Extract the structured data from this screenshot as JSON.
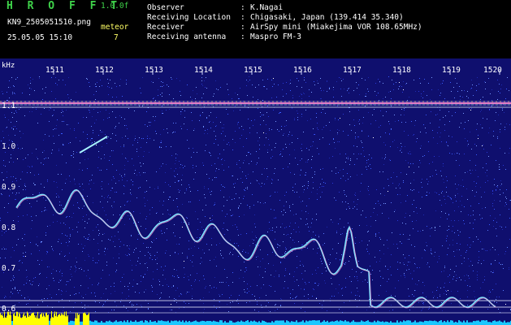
{
  "app": {
    "name": "H R O F F T",
    "version": "1.0.0f"
  },
  "file": {
    "name": "KN9_2505051510.png",
    "datetime": "25.05.05 15:10"
  },
  "meteor": {
    "label": "meteor",
    "count": "7"
  },
  "info": [
    {
      "label": "Observer",
      "value": "K.Nagai"
    },
    {
      "label": "Receiving Location",
      "value": "Chigasaki, Japan (139.414 35.340)"
    },
    {
      "label": "Receiver",
      "value": "AirSpy mini (Miakejima VOR 108.65MHz)"
    },
    {
      "label": "Receiving antenna",
      "value": "Maspro FM-3"
    }
  ],
  "spectrogram": {
    "y_unit": "kHz",
    "time_labels": [
      "1511",
      "1512",
      "1513",
      "1514",
      "1515",
      "1516",
      "1517",
      "1518",
      "1519",
      "1520"
    ],
    "freq_labels": [
      "1.1",
      "1.0",
      "0.9",
      "0.8",
      "0.7",
      "0.6"
    ],
    "colors": {
      "background": "#0f0f6e",
      "noise": "#3a5cff",
      "carrier": "#ff8ccf",
      "grid": "#cfd3ff",
      "echo": "#7fe6ff",
      "meteor_bar": "#ffff00",
      "level": "#19c8ff"
    }
  }
}
